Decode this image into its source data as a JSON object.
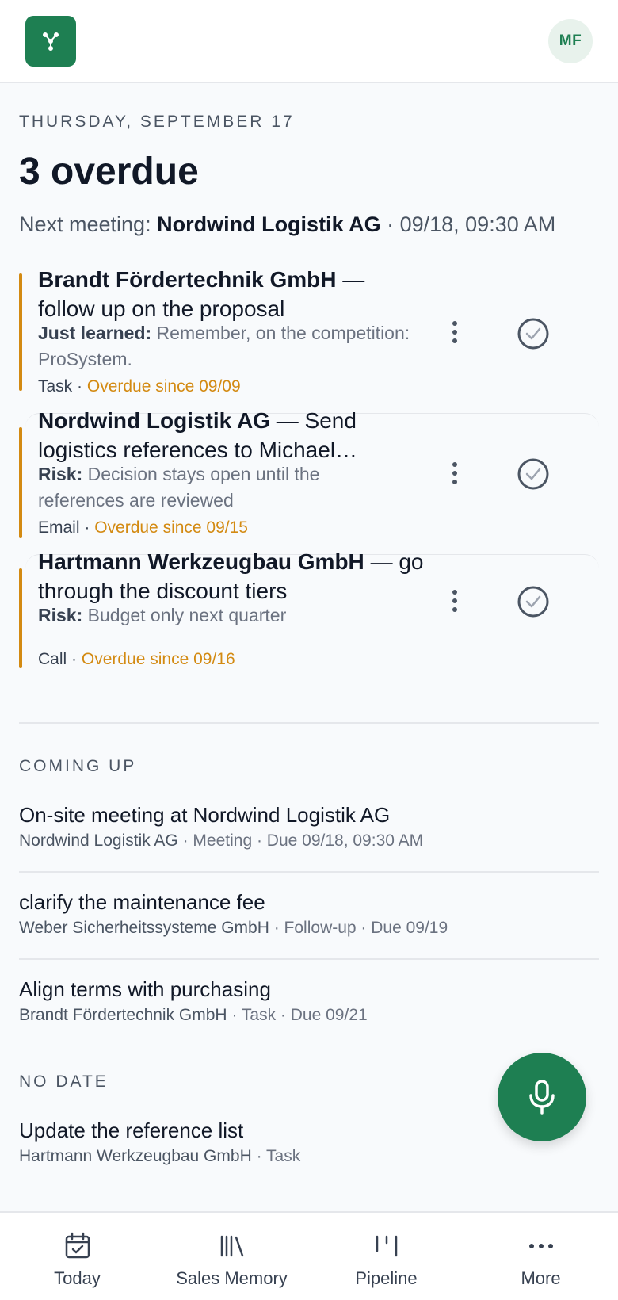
{
  "header": {
    "logo_icon": "network-nodes-icon",
    "avatar_initials": "MF",
    "brand_color": "#1e7f52"
  },
  "summary": {
    "date": "Thursday, September 17",
    "headline": "3 overdue",
    "next_meeting_prefix": "Next meeting:",
    "next_meeting_company": "Nordwind Logistik AG",
    "next_meeting_time": "· 09/18, 09:30 AM"
  },
  "overdue": [
    {
      "company": "Brandt Fördertechnik GmbH",
      "title_rest": "— follow up on the proposal",
      "note_label": "Just learned:",
      "note_text": "Remember, on the competition: ProSystem.",
      "type": "Task",
      "overdue_text": "Overdue since 09/09"
    },
    {
      "company": "Nordwind Logistik AG",
      "title_rest": "— Send logistics references to Michael…",
      "note_label": "Risk:",
      "note_text": "Decision stays open until the references are reviewed",
      "type": "Email",
      "overdue_text": "Overdue since 09/15"
    },
    {
      "company": "Hartmann Werkzeugbau GmbH",
      "title_rest": "— go through the discount tiers",
      "note_label": "Risk:",
      "note_text": "Budget only next quarter",
      "type": "Call",
      "overdue_text": "Overdue since 09/16"
    }
  ],
  "coming_up": {
    "label": "Coming up",
    "items": [
      {
        "title": "On-site meeting at Nordwind Logistik AG",
        "company": "Nordwind Logistik AG",
        "details": " · Meeting · Due 09/18, 09:30 AM"
      },
      {
        "title": "clarify the maintenance fee",
        "company": "Weber Sicherheitssysteme GmbH",
        "details": " · Follow-up · Due 09/19"
      },
      {
        "title": "Align terms with purchasing",
        "company": "Brandt Fördertechnik GmbH",
        "details": " · Task · Due 09/21"
      }
    ]
  },
  "no_date": {
    "label": "No date",
    "items": [
      {
        "title": "Update the reference list",
        "company": "Hartmann Werkzeugbau GmbH",
        "details": " · Task"
      }
    ]
  },
  "fab_icon": "microphone-icon",
  "tabs": [
    {
      "label": "Today",
      "icon": "calendar-check-icon"
    },
    {
      "label": "Sales Memory",
      "icon": "library-icon"
    },
    {
      "label": "Pipeline",
      "icon": "pipeline-icon"
    },
    {
      "label": "More",
      "icon": "more-dots-icon"
    }
  ],
  "colors": {
    "overdue": "#d38a12",
    "accent": "#1e7f52"
  }
}
